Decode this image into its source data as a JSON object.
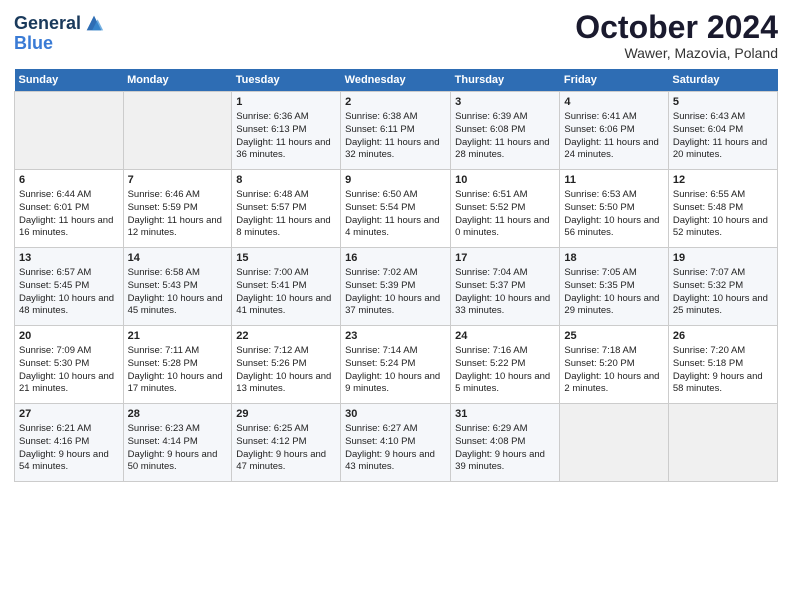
{
  "header": {
    "logo_line1": "General",
    "logo_line2": "Blue",
    "month": "October 2024",
    "location": "Wawer, Mazovia, Poland"
  },
  "weekdays": [
    "Sunday",
    "Monday",
    "Tuesday",
    "Wednesday",
    "Thursday",
    "Friday",
    "Saturday"
  ],
  "weeks": [
    [
      {
        "day": "",
        "info": ""
      },
      {
        "day": "",
        "info": ""
      },
      {
        "day": "1",
        "info": "Sunrise: 6:36 AM\nSunset: 6:13 PM\nDaylight: 11 hours and 36 minutes."
      },
      {
        "day": "2",
        "info": "Sunrise: 6:38 AM\nSunset: 6:11 PM\nDaylight: 11 hours and 32 minutes."
      },
      {
        "day": "3",
        "info": "Sunrise: 6:39 AM\nSunset: 6:08 PM\nDaylight: 11 hours and 28 minutes."
      },
      {
        "day": "4",
        "info": "Sunrise: 6:41 AM\nSunset: 6:06 PM\nDaylight: 11 hours and 24 minutes."
      },
      {
        "day": "5",
        "info": "Sunrise: 6:43 AM\nSunset: 6:04 PM\nDaylight: 11 hours and 20 minutes."
      }
    ],
    [
      {
        "day": "6",
        "info": "Sunrise: 6:44 AM\nSunset: 6:01 PM\nDaylight: 11 hours and 16 minutes."
      },
      {
        "day": "7",
        "info": "Sunrise: 6:46 AM\nSunset: 5:59 PM\nDaylight: 11 hours and 12 minutes."
      },
      {
        "day": "8",
        "info": "Sunrise: 6:48 AM\nSunset: 5:57 PM\nDaylight: 11 hours and 8 minutes."
      },
      {
        "day": "9",
        "info": "Sunrise: 6:50 AM\nSunset: 5:54 PM\nDaylight: 11 hours and 4 minutes."
      },
      {
        "day": "10",
        "info": "Sunrise: 6:51 AM\nSunset: 5:52 PM\nDaylight: 11 hours and 0 minutes."
      },
      {
        "day": "11",
        "info": "Sunrise: 6:53 AM\nSunset: 5:50 PM\nDaylight: 10 hours and 56 minutes."
      },
      {
        "day": "12",
        "info": "Sunrise: 6:55 AM\nSunset: 5:48 PM\nDaylight: 10 hours and 52 minutes."
      }
    ],
    [
      {
        "day": "13",
        "info": "Sunrise: 6:57 AM\nSunset: 5:45 PM\nDaylight: 10 hours and 48 minutes."
      },
      {
        "day": "14",
        "info": "Sunrise: 6:58 AM\nSunset: 5:43 PM\nDaylight: 10 hours and 45 minutes."
      },
      {
        "day": "15",
        "info": "Sunrise: 7:00 AM\nSunset: 5:41 PM\nDaylight: 10 hours and 41 minutes."
      },
      {
        "day": "16",
        "info": "Sunrise: 7:02 AM\nSunset: 5:39 PM\nDaylight: 10 hours and 37 minutes."
      },
      {
        "day": "17",
        "info": "Sunrise: 7:04 AM\nSunset: 5:37 PM\nDaylight: 10 hours and 33 minutes."
      },
      {
        "day": "18",
        "info": "Sunrise: 7:05 AM\nSunset: 5:35 PM\nDaylight: 10 hours and 29 minutes."
      },
      {
        "day": "19",
        "info": "Sunrise: 7:07 AM\nSunset: 5:32 PM\nDaylight: 10 hours and 25 minutes."
      }
    ],
    [
      {
        "day": "20",
        "info": "Sunrise: 7:09 AM\nSunset: 5:30 PM\nDaylight: 10 hours and 21 minutes."
      },
      {
        "day": "21",
        "info": "Sunrise: 7:11 AM\nSunset: 5:28 PM\nDaylight: 10 hours and 17 minutes."
      },
      {
        "day": "22",
        "info": "Sunrise: 7:12 AM\nSunset: 5:26 PM\nDaylight: 10 hours and 13 minutes."
      },
      {
        "day": "23",
        "info": "Sunrise: 7:14 AM\nSunset: 5:24 PM\nDaylight: 10 hours and 9 minutes."
      },
      {
        "day": "24",
        "info": "Sunrise: 7:16 AM\nSunset: 5:22 PM\nDaylight: 10 hours and 5 minutes."
      },
      {
        "day": "25",
        "info": "Sunrise: 7:18 AM\nSunset: 5:20 PM\nDaylight: 10 hours and 2 minutes."
      },
      {
        "day": "26",
        "info": "Sunrise: 7:20 AM\nSunset: 5:18 PM\nDaylight: 9 hours and 58 minutes."
      }
    ],
    [
      {
        "day": "27",
        "info": "Sunrise: 6:21 AM\nSunset: 4:16 PM\nDaylight: 9 hours and 54 minutes."
      },
      {
        "day": "28",
        "info": "Sunrise: 6:23 AM\nSunset: 4:14 PM\nDaylight: 9 hours and 50 minutes."
      },
      {
        "day": "29",
        "info": "Sunrise: 6:25 AM\nSunset: 4:12 PM\nDaylight: 9 hours and 47 minutes."
      },
      {
        "day": "30",
        "info": "Sunrise: 6:27 AM\nSunset: 4:10 PM\nDaylight: 9 hours and 43 minutes."
      },
      {
        "day": "31",
        "info": "Sunrise: 6:29 AM\nSunset: 4:08 PM\nDaylight: 9 hours and 39 minutes."
      },
      {
        "day": "",
        "info": ""
      },
      {
        "day": "",
        "info": ""
      }
    ]
  ]
}
